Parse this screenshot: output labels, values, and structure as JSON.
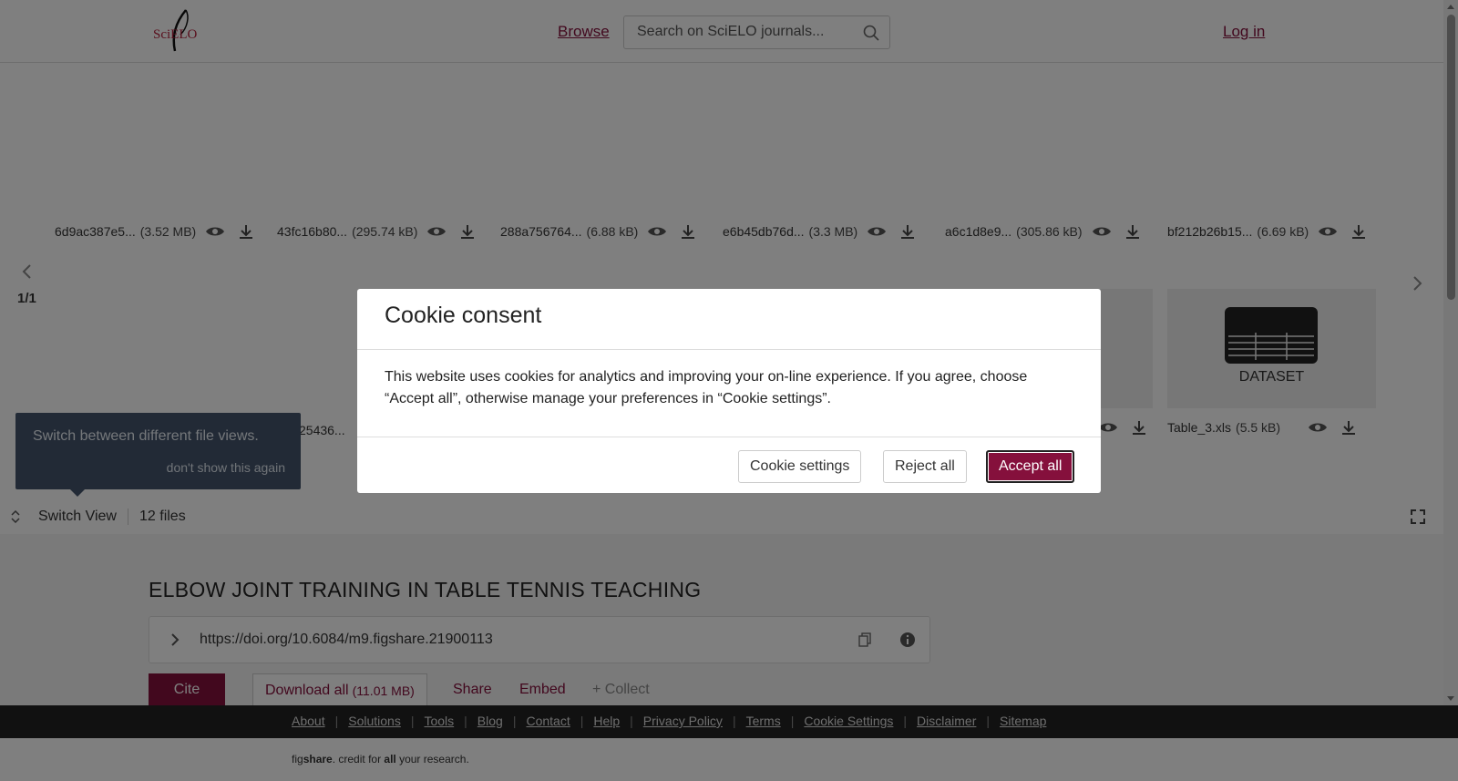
{
  "header": {
    "logo_text": "SciELO",
    "browse": "Browse",
    "search_placeholder": "Search on SciELO journals...",
    "login": "Log in"
  },
  "viewer": {
    "files_top": [
      {
        "name": "6d9ac387e5...",
        "size": "(3.52 MB)"
      },
      {
        "name": "43fc16b80...",
        "size": "(295.74 kB)"
      },
      {
        "name": "288a756764...",
        "size": "(6.88 kB)"
      },
      {
        "name": "e6b45db76d...",
        "size": "(3.3 MB)"
      },
      {
        "name": "a6c1d8e9...",
        "size": "(305.86 kB)"
      },
      {
        "name": "bf212b26b15...",
        "size": "(6.69 kB)"
      }
    ],
    "pager": "1/1",
    "dataset_label": "DATASET",
    "bottom_file": {
      "name": "Table_3.xls",
      "size": "(5.5 kB)"
    },
    "partial_name": "25436...",
    "tooltip": {
      "text": "Switch between different file views.",
      "dismiss": "don't show this again"
    },
    "switch_view": "Switch View",
    "file_count": "12 files"
  },
  "article": {
    "title": "ELBOW JOINT TRAINING IN TABLE TENNIS TEACHING",
    "doi": "https://doi.org/10.6084/m9.figshare.21900113",
    "cite": "Cite",
    "download_all": "Download all",
    "download_size": "(11.01 MB)",
    "share": "Share",
    "embed": "Embed",
    "collect": "+ Collect"
  },
  "footer": {
    "links": [
      "About",
      "Solutions",
      "Tools",
      "Blog",
      "Contact",
      "Help",
      "Privacy Policy",
      "Terms",
      "Cookie Settings",
      "Disclaimer",
      "Sitemap"
    ],
    "credit_pre": "fig",
    "credit_brand": "share",
    "credit_mid": ". credit for ",
    "credit_all": "all",
    "credit_post": " your research."
  },
  "cookie_modal": {
    "title": "Cookie consent",
    "body": "This website uses cookies for analytics and improving your on-line experience. If you agree, choose “Accept all”, otherwise manage your preferences in “Cookie settings”.",
    "settings": "Cookie settings",
    "reject": "Reject all",
    "accept": "Accept all"
  },
  "colors": {
    "brand": "#85103c",
    "tooltip": "#45556c",
    "footer": "#222222"
  },
  "icons": [
    "search-icon",
    "eye-icon",
    "download-icon",
    "chevron-left-icon",
    "chevron-right-icon",
    "table-icon",
    "switch-icon",
    "fullscreen-icon",
    "chevron-right-icon",
    "copy-icon",
    "info-icon"
  ]
}
